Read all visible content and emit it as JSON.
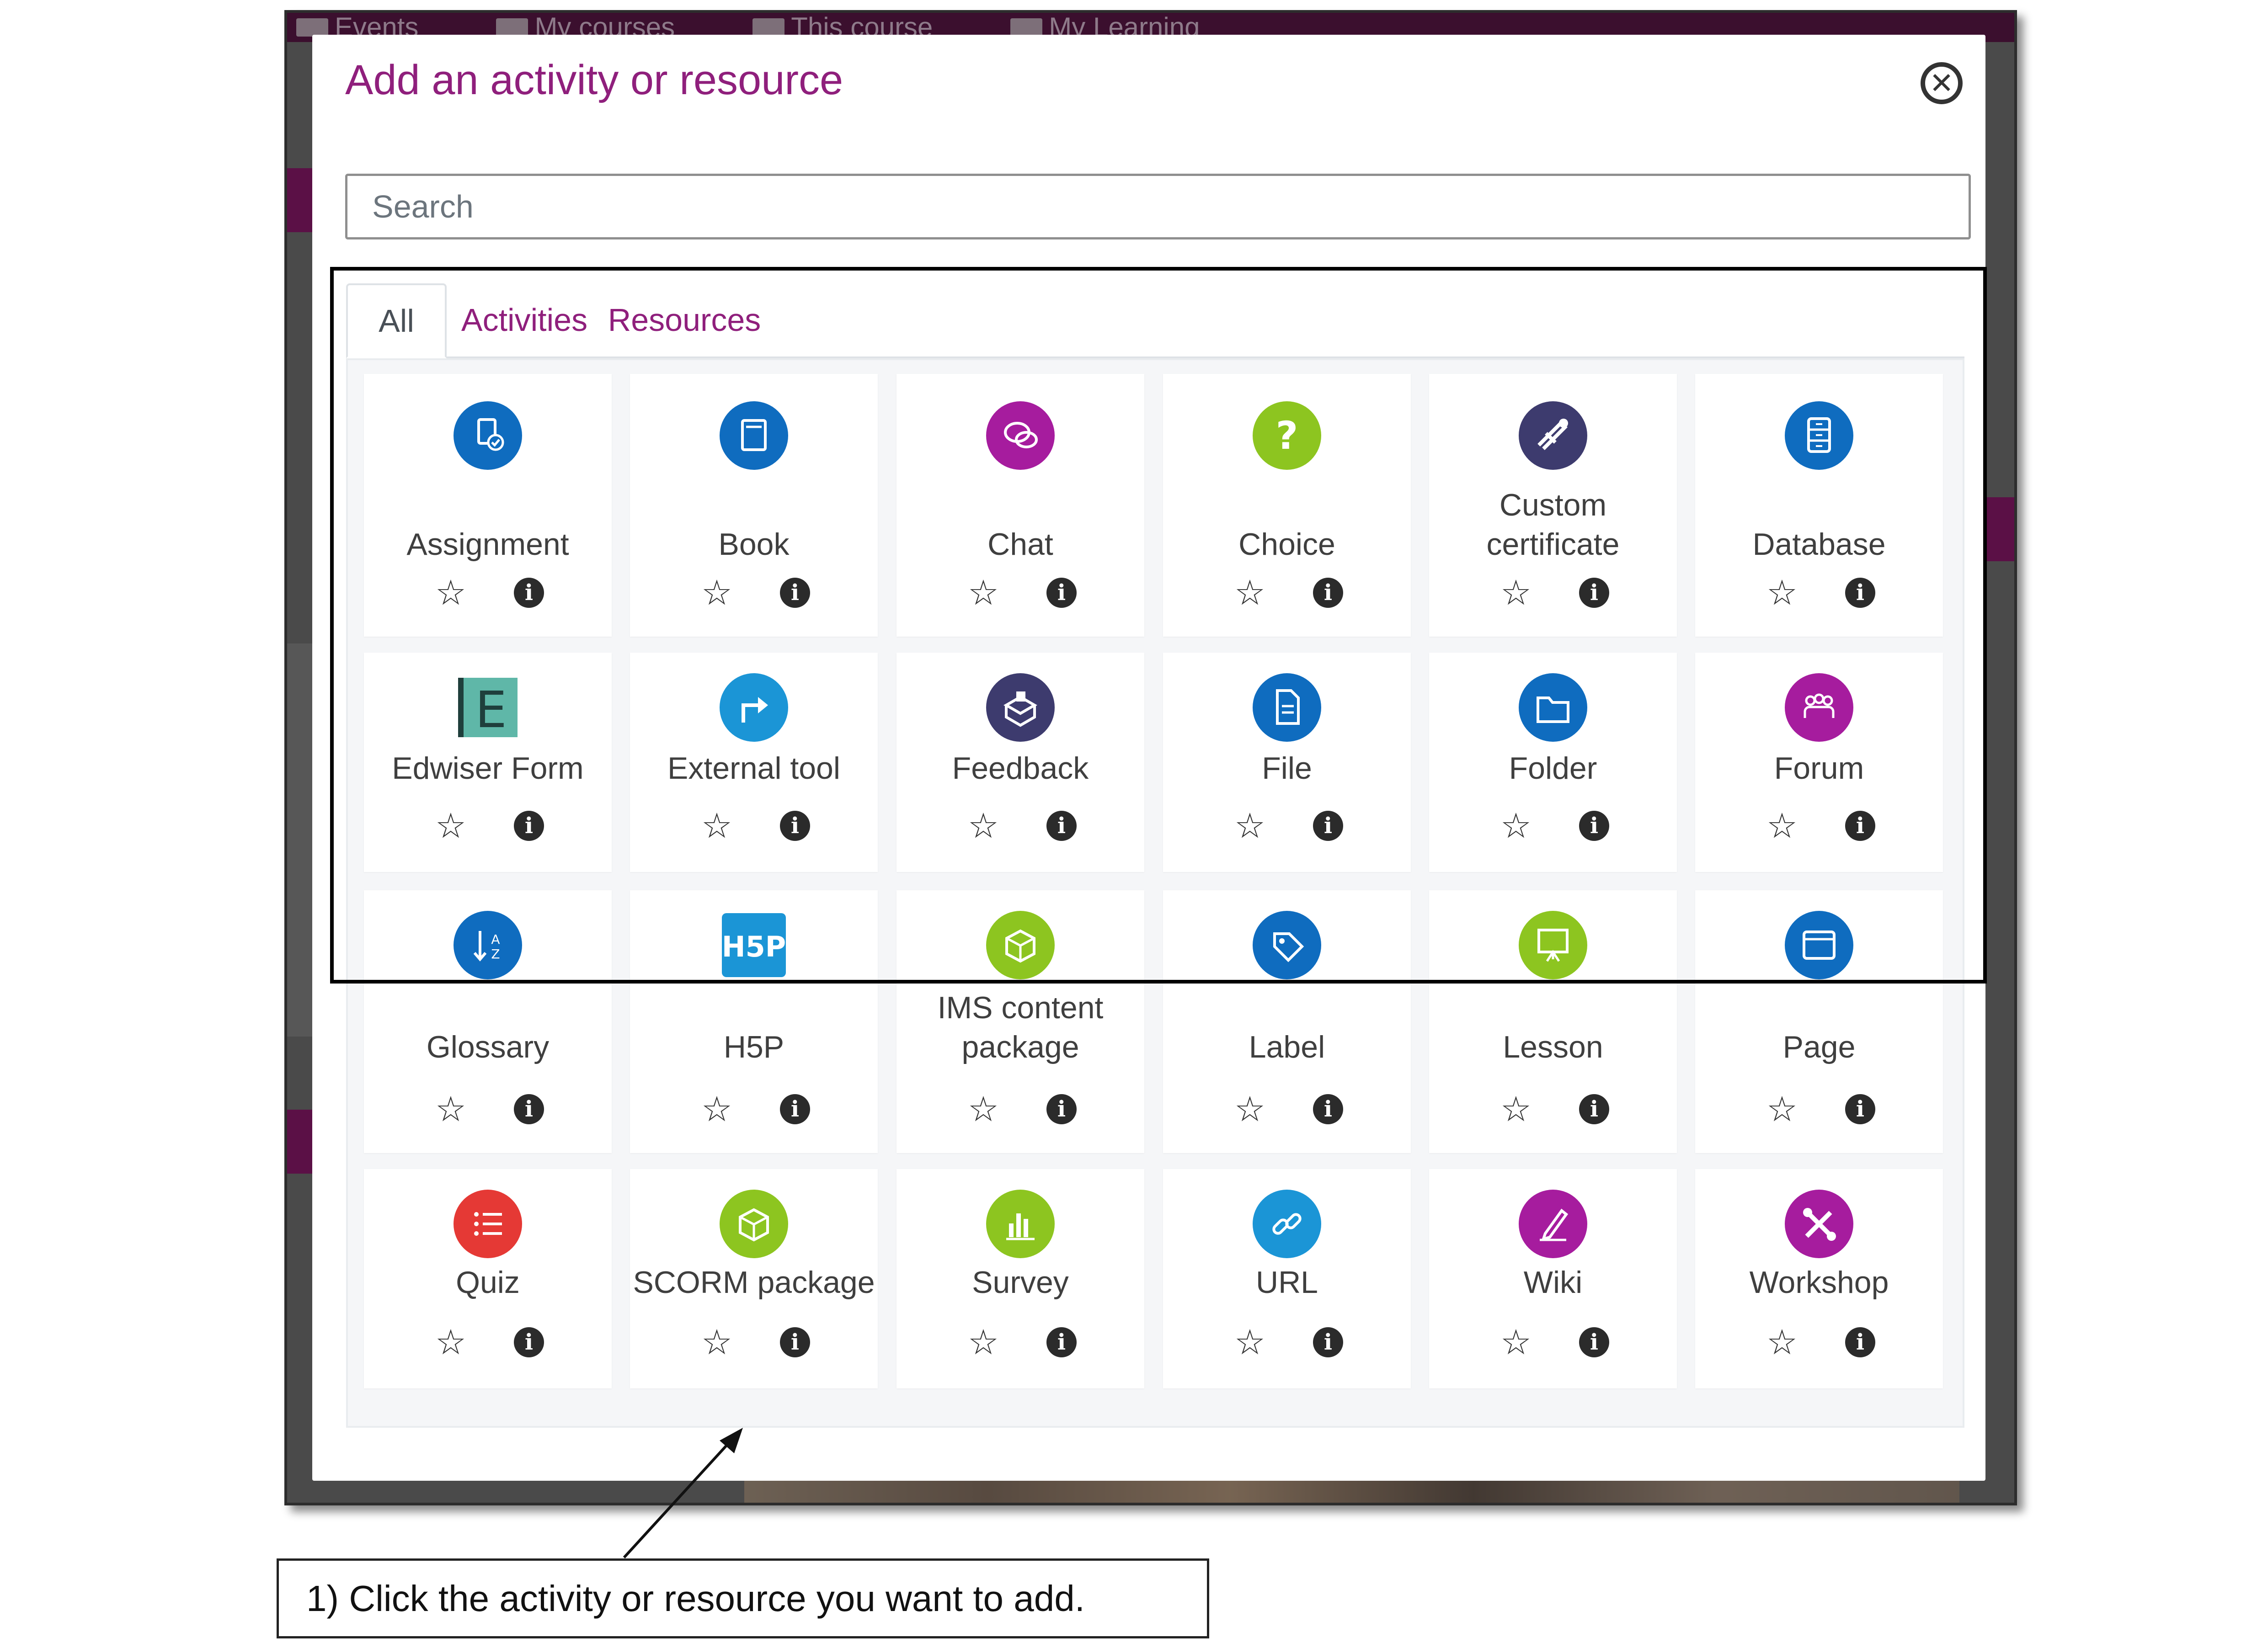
{
  "background": {
    "nav": [
      {
        "label": "Events"
      },
      {
        "label": "My courses"
      },
      {
        "label": "This course"
      },
      {
        "label": "My Learning"
      }
    ]
  },
  "modal": {
    "title": "Add an activity or resource",
    "close_icon": "close-circle-icon",
    "search_placeholder": "Search",
    "tabs": [
      {
        "label": "All",
        "active": true
      },
      {
        "label": "Activities",
        "active": false
      },
      {
        "label": "Resources",
        "active": false
      }
    ],
    "items": [
      {
        "name": "Assignment",
        "icon": "assignment-icon",
        "color": "#0f6cbf"
      },
      {
        "name": "Book",
        "icon": "book-icon",
        "color": "#0f6cbf"
      },
      {
        "name": "Chat",
        "icon": "chat-icon",
        "color": "#a61c9e"
      },
      {
        "name": "Choice",
        "icon": "question-icon",
        "color": "#8dc520"
      },
      {
        "name": "Custom certificate",
        "icon": "certificate-icon",
        "color": "#3d3b6e"
      },
      {
        "name": "Database",
        "icon": "database-icon",
        "color": "#0f6cbf"
      },
      {
        "name": "Edwiser Form",
        "icon": "edwiser-form-icon",
        "color": "#3a9c92"
      },
      {
        "name": "External tool",
        "icon": "external-tool-icon",
        "color": "#1b95d6"
      },
      {
        "name": "Feedback",
        "icon": "feedback-icon",
        "color": "#3d3b6e"
      },
      {
        "name": "File",
        "icon": "file-icon",
        "color": "#0f6cbf"
      },
      {
        "name": "Folder",
        "icon": "folder-icon",
        "color": "#0f6cbf"
      },
      {
        "name": "Forum",
        "icon": "forum-icon",
        "color": "#a61c9e"
      },
      {
        "name": "Glossary",
        "icon": "glossary-icon",
        "color": "#0f6cbf"
      },
      {
        "name": "H5P",
        "icon": "h5p-icon",
        "color": "#1b95d6"
      },
      {
        "name": "IMS content package",
        "icon": "package-icon",
        "color": "#8dc520"
      },
      {
        "name": "Label",
        "icon": "label-icon",
        "color": "#0f6cbf"
      },
      {
        "name": "Lesson",
        "icon": "lesson-icon",
        "color": "#8dc520"
      },
      {
        "name": "Page",
        "icon": "page-icon",
        "color": "#0f6cbf"
      },
      {
        "name": "Quiz",
        "icon": "quiz-icon",
        "color": "#e53935"
      },
      {
        "name": "SCORM package",
        "icon": "scorm-icon",
        "color": "#8dc520"
      },
      {
        "name": "Survey",
        "icon": "survey-icon",
        "color": "#8dc520"
      },
      {
        "name": "URL",
        "icon": "link-icon",
        "color": "#1b95d6"
      },
      {
        "name": "Wiki",
        "icon": "wiki-icon",
        "color": "#a61c9e"
      },
      {
        "name": "Workshop",
        "icon": "workshop-icon",
        "color": "#a61c9e"
      }
    ]
  },
  "annotation": {
    "text": "1) Click the activity or resource you want to add."
  },
  "colors": {
    "accent": "#8f1f7c",
    "nav_background": "#3b0f2e"
  }
}
